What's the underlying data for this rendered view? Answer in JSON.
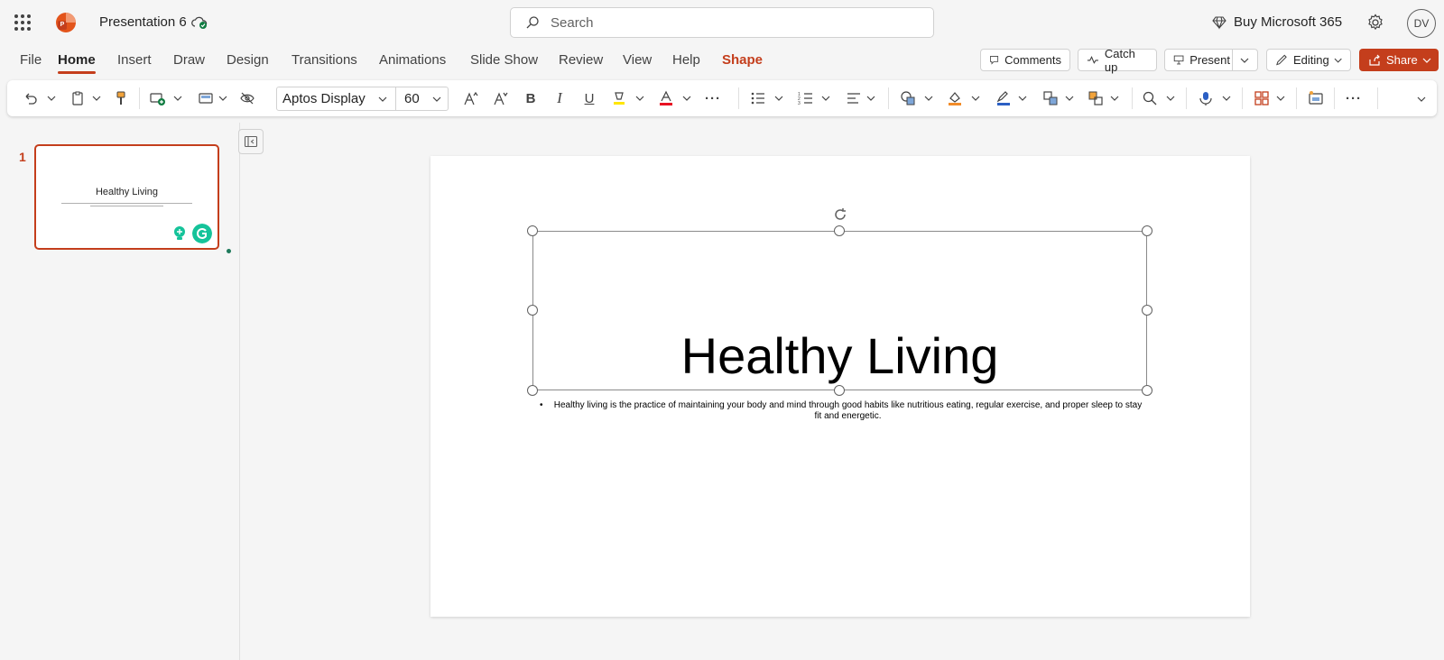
{
  "app": {
    "title": "Presentation 6",
    "search_placeholder": "Search",
    "buy_label": "Buy Microsoft 365",
    "avatar_initials": "DV"
  },
  "tabs": [
    "File",
    "Home",
    "Insert",
    "Draw",
    "Design",
    "Transitions",
    "Animations",
    "Slide Show",
    "Review",
    "View",
    "Help",
    "Shape"
  ],
  "actions": {
    "comments": "Comments",
    "catch_up": "Catch up",
    "present": "Present",
    "editing": "Editing",
    "share": "Share"
  },
  "ribbon": {
    "font_name": "Aptos Display",
    "font_size": "60",
    "bold": "B",
    "italic": "I",
    "underline": "U",
    "more": "···"
  },
  "thumbnail": {
    "number": "1",
    "title": "Healthy Living"
  },
  "slide": {
    "title": "Healthy Living",
    "bullet": "•",
    "body": "Healthy living is the practice of maintaining your body and mind through good habits like nutritious eating, regular exercise, and proper sleep to stay fit and energetic."
  },
  "colors": {
    "accent": "#c43e1c",
    "grammarly": "#15c39a"
  }
}
